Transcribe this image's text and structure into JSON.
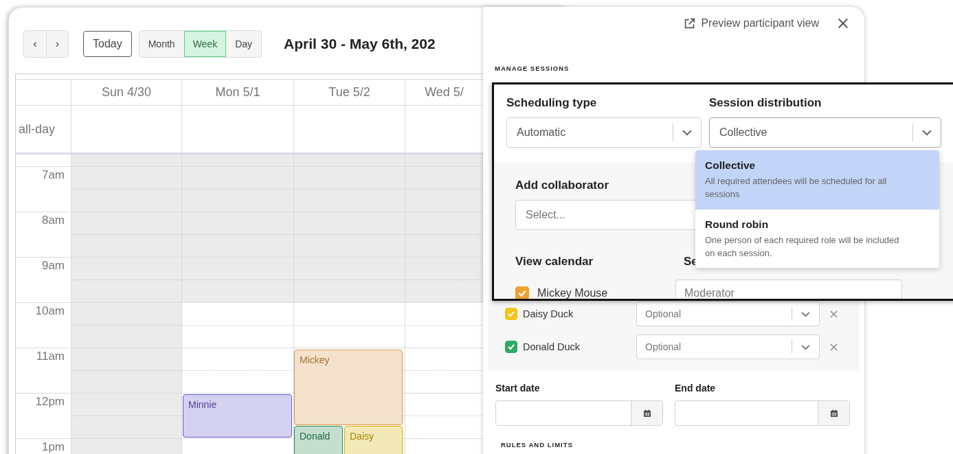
{
  "calendar": {
    "nav_buttons": [
      "‹",
      "›"
    ],
    "today_button": "Today",
    "views": [
      {
        "label": "Month",
        "selected": false
      },
      {
        "label": "Week",
        "selected": true
      },
      {
        "label": "Day",
        "selected": false
      }
    ],
    "title": "April 30 - May 6th, 202",
    "days": [
      {
        "label": "Sun 4/30",
        "unavailable": true
      },
      {
        "label": "Mon 5/1",
        "unavailable": false
      },
      {
        "label": "Tue 5/2",
        "unavailable": false
      },
      {
        "label": "Wed 5/",
        "unavailable": false
      }
    ],
    "all_day_label": "all-day",
    "hours": [
      {
        "label": "7am",
        "unavailable": true
      },
      {
        "label": "8am",
        "unavailable": true
      },
      {
        "label": "9am",
        "unavailable": true
      },
      {
        "label": "10am",
        "unavailable": false
      },
      {
        "label": "11am",
        "unavailable": false
      },
      {
        "label": "12pm",
        "unavailable": false
      },
      {
        "label": "1pm",
        "unavailable": false
      }
    ],
    "events": [
      {
        "title": "Mickey",
        "color": "#d9964a"
      },
      {
        "title": "Minnie",
        "color": "#6a5acd"
      },
      {
        "title": "Donald",
        "color": "#2e8b57"
      },
      {
        "title": "Daisy",
        "color": "#d4b200"
      }
    ]
  },
  "panel": {
    "preview_link": "Preview participant view",
    "section_title": "MANAGE SESSIONS",
    "participants": [
      {
        "name": "Daisy Duck",
        "checked": true,
        "color": "#f5c518",
        "role": "Optional"
      },
      {
        "name": "Donald Duck",
        "checked": true,
        "color": "#2faa63",
        "role": "Optional"
      }
    ],
    "start_date": {
      "label": "Start date"
    },
    "end_date": {
      "label": "End date"
    },
    "rules_title": "RULES AND LIMITS"
  },
  "callout": {
    "scheduling_type": {
      "label": "Scheduling type",
      "value": "Automatic"
    },
    "session_distribution": {
      "label": "Session distribution",
      "value": "Collective",
      "expanded": true,
      "options": [
        {
          "title": "Collective",
          "description": "All required attendees will be scheduled for all sessions",
          "selected": true
        },
        {
          "title": "Round robin",
          "description": "One person of each required role will be included on each session.",
          "selected": false
        }
      ]
    },
    "add_collaborator": {
      "label": "Add collaborator",
      "placeholder": "Select..."
    },
    "view_calendar": "View calendar",
    "role_heading": "Se",
    "participants": [
      {
        "name": "Mickey Mouse",
        "checked": true,
        "color": "#f0a030",
        "role": "Moderator"
      }
    ]
  }
}
